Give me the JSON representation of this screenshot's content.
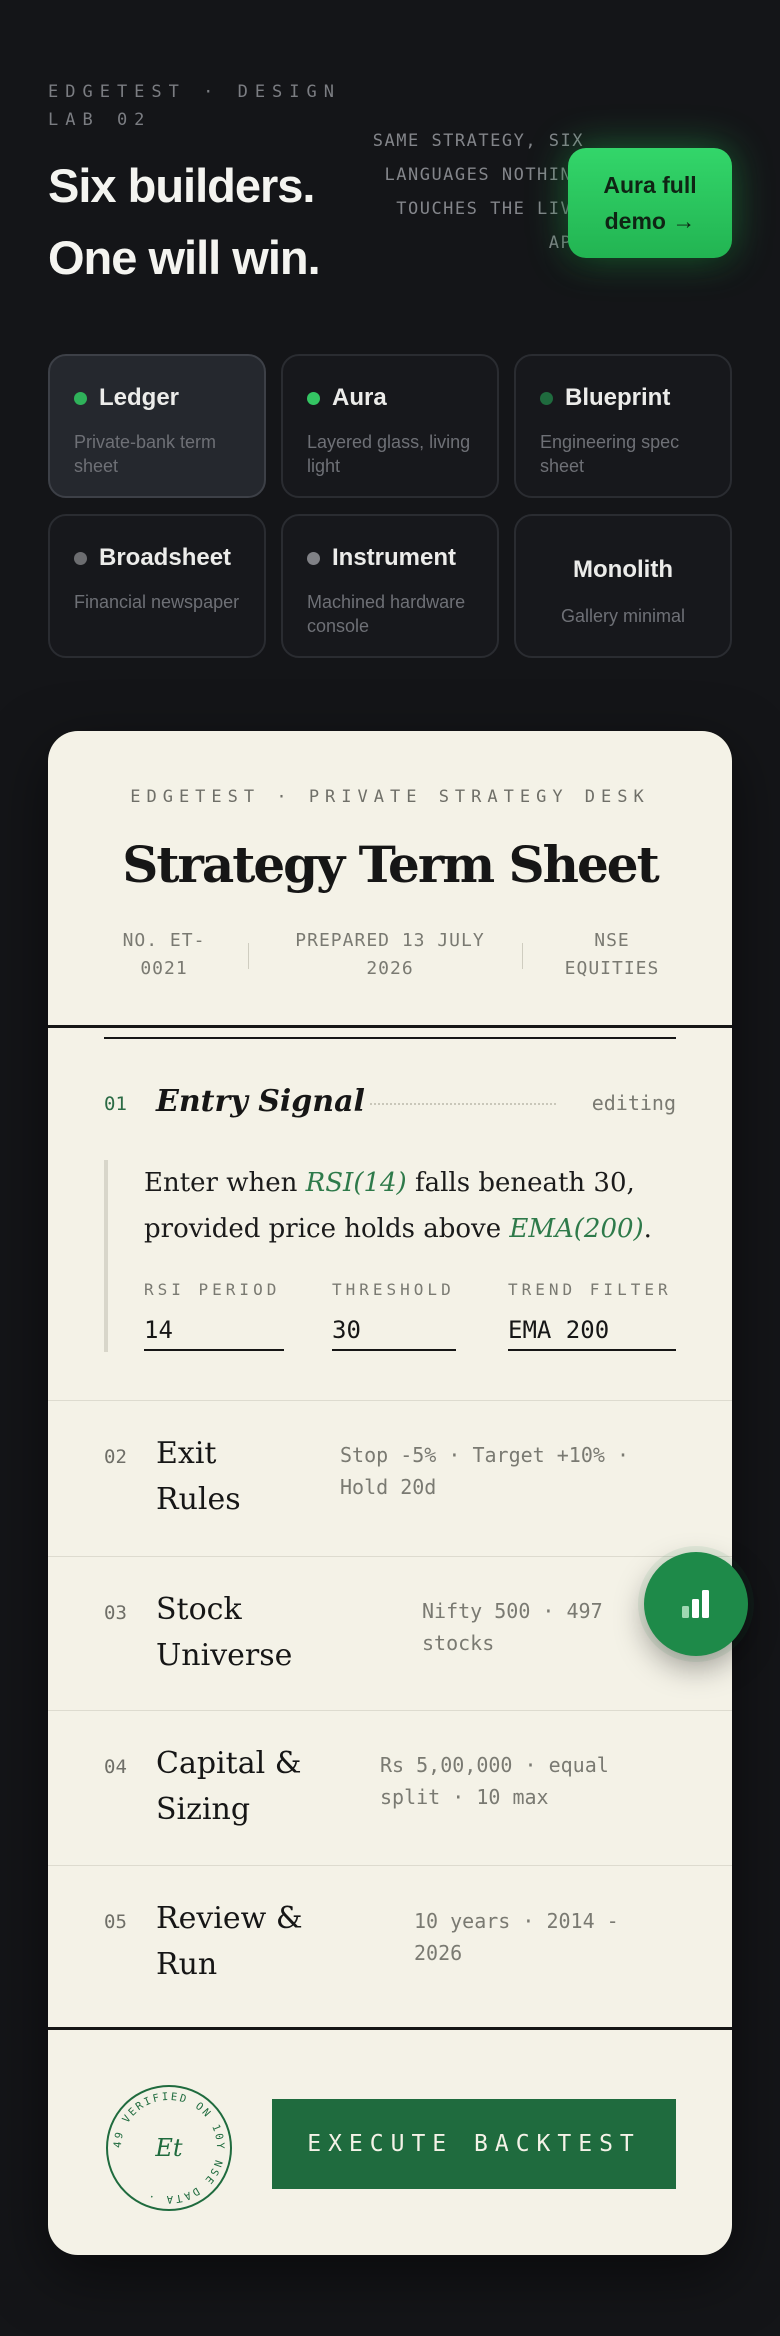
{
  "header": {
    "brand": "EDGETEST · DESIGN LAB 02",
    "headline_line1": "Six builders.",
    "headline_line2": "One will win.",
    "tagline": "SAME STRATEGY, SIX LANGUAGES NOTHING TOUCHES THE LIVE APP",
    "demo_button": "Aura full demo →"
  },
  "builders": [
    {
      "name": "Ledger",
      "desc": "Private-bank term sheet",
      "dot": "#2fb25a",
      "active": true
    },
    {
      "name": "Aura",
      "desc": "Layered glass, living light",
      "dot": "#34c563",
      "active": false
    },
    {
      "name": "Blueprint",
      "desc": "Engineering spec sheet",
      "dot": "#1f6b3e",
      "active": false
    },
    {
      "name": "Broadsheet",
      "desc": "Financial newspaper",
      "dot": "#6c6d70",
      "active": false
    },
    {
      "name": "Instrument",
      "desc": "Machined hardware console",
      "dot": "#808186",
      "active": false
    },
    {
      "name": "Monolith",
      "desc": "Gallery minimal",
      "dot": "",
      "active": false
    }
  ],
  "sheet": {
    "desk": "EDGETEST · PRIVATE STRATEGY DESK",
    "title": "Strategy Term Sheet",
    "meta_no": "NO. ET-0021",
    "meta_prepared": "PREPARED 13 JULY 2026",
    "meta_market": "NSE EQUITIES",
    "sections": [
      {
        "num": "01",
        "title": "Entry Signal",
        "status": "editing"
      },
      {
        "num": "02",
        "title": "Exit Rules",
        "detail": "Stop -5% · Target +10% · Hold 20d"
      },
      {
        "num": "03",
        "title": "Stock Universe",
        "detail": "Nifty 500 · 497 stocks"
      },
      {
        "num": "04",
        "title": "Capital & Sizing",
        "detail": "Rs 5,00,000 · equal split · 10 max"
      },
      {
        "num": "05",
        "title": "Review & Run",
        "detail": "10 years · 2014 - 2026"
      }
    ],
    "signal": {
      "t1": "Enter when ",
      "rsi": "RSI(14)",
      "t2": " falls beneath 30,",
      "t3": "provided price holds above ",
      "ema": "EMA(200)",
      "t4": "."
    },
    "params": {
      "rsi_label": "RSI PERIOD",
      "rsi_value": "14",
      "threshold_label": "THRESHOLD",
      "threshold_value": "30",
      "trend_label": "TREND FILTER",
      "trend_value": "EMA 200"
    },
    "seal_ring": "49 VERIFIED ON 10Y NSE DATA ·",
    "seal_mark": "Et",
    "execute": "EXECUTE BACKTEST"
  }
}
